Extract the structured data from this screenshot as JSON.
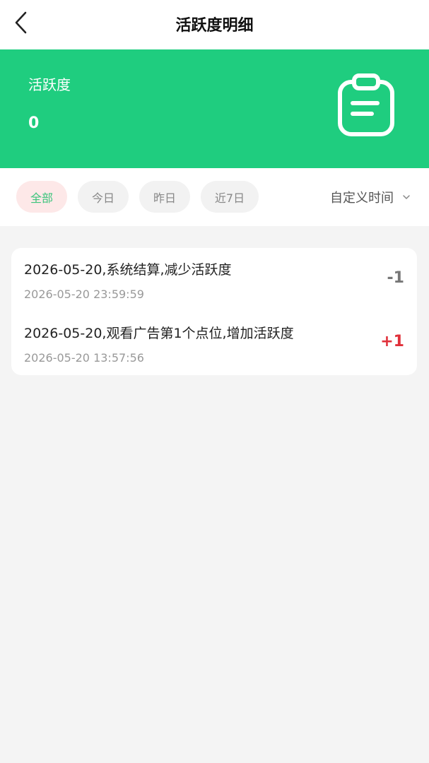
{
  "header": {
    "title": "活跃度明细",
    "back_icon": "chevron-left-icon"
  },
  "banner": {
    "background": "#1fcd7f",
    "label": "活跃度",
    "value": "0",
    "icon": "clipboard-icon"
  },
  "filters": {
    "chips": [
      {
        "label": "全部",
        "active": true
      },
      {
        "label": "今日",
        "active": false
      },
      {
        "label": "昨日",
        "active": false
      },
      {
        "label": "近7日",
        "active": false
      }
    ],
    "active_color": "#3cc47c",
    "custom_time_label": "自定义时间",
    "custom_time_icon": "chevron-down-icon"
  },
  "records": [
    {
      "title": "2026-05-20,系统结算,减少活跃度",
      "time": "2026-05-20 23:59:59",
      "amount": "-1",
      "color": "#777777"
    },
    {
      "title": "2026-05-20,观看广告第1个点位,增加活跃度",
      "time": "2026-05-20 13:57:56",
      "amount": "+1",
      "color": "#e0303a"
    }
  ]
}
